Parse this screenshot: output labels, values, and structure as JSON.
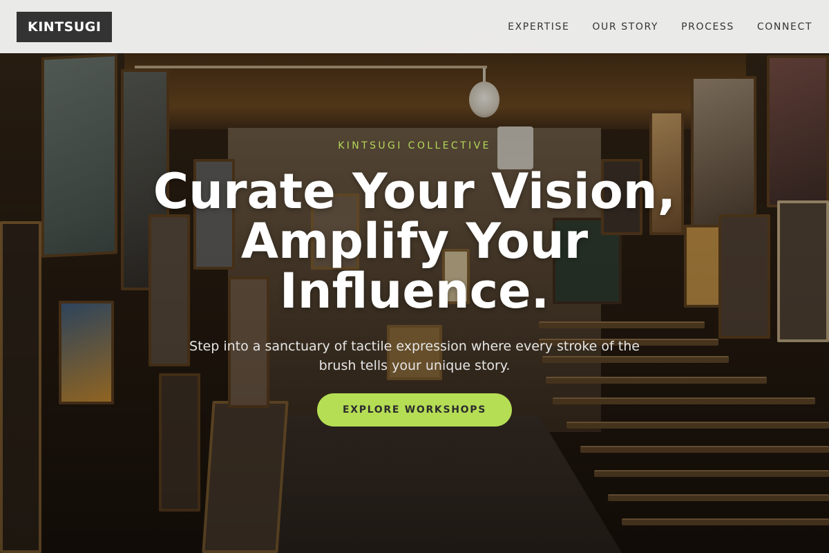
{
  "brand": {
    "logo_text": "KINTSUGI"
  },
  "nav": {
    "items": [
      {
        "label": "EXPERTISE"
      },
      {
        "label": "OUR STORY"
      },
      {
        "label": "PROCESS"
      },
      {
        "label": "CONNECT"
      }
    ]
  },
  "hero": {
    "eyebrow": "KINTSUGI COLLECTIVE",
    "headline": "Curate Your Vision, Amplify Your Influence.",
    "subtext": "Step into a sanctuary of tactile expression where every stroke of the brush tells your unique story.",
    "cta_label": "EXPLORE WORKSHOPS",
    "background_image": "art-studio-hallway-photo"
  },
  "colors": {
    "header_bg": "#f2f2f2",
    "logo_bg": "#333333",
    "accent": "#b5de55",
    "eyebrow": "#b5d85a",
    "headline": "#ffffff",
    "body_text": "#e6e6e6"
  }
}
